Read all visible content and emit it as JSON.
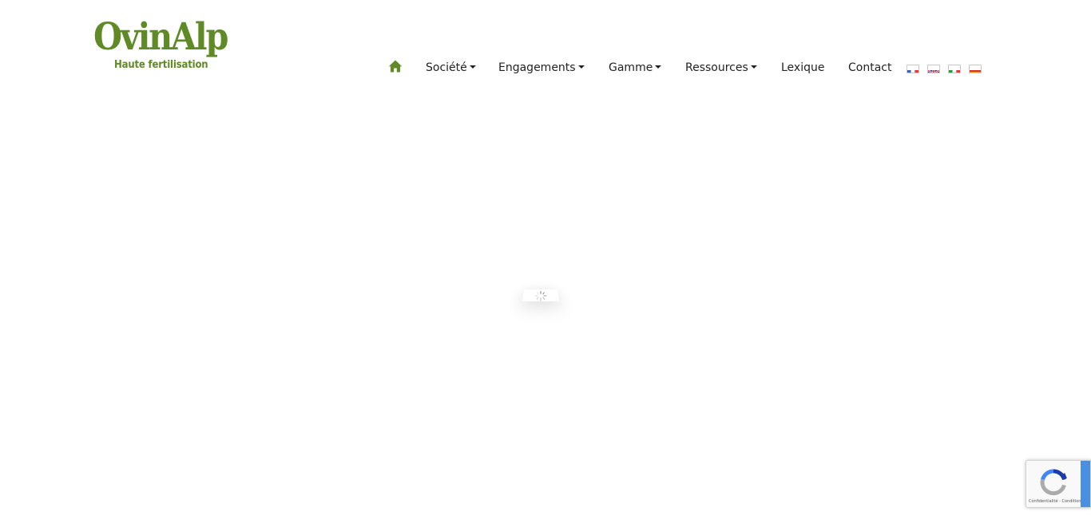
{
  "brand": {
    "name": "OvinAlp",
    "tagline": "Haute fertilisation",
    "color": "#5f8a26"
  },
  "nav": {
    "home_icon": "home-icon",
    "items": [
      {
        "label": "Société",
        "dropdown": true
      },
      {
        "label": "Engagements",
        "dropdown": true
      },
      {
        "label": "Gamme",
        "dropdown": true
      },
      {
        "label": "Ressources",
        "dropdown": true
      },
      {
        "label": "Lexique",
        "dropdown": false
      },
      {
        "label": "Contact",
        "dropdown": false
      }
    ],
    "languages": [
      {
        "code": "fr",
        "icon": "flag-france-icon"
      },
      {
        "code": "en",
        "icon": "flag-uk-icon"
      },
      {
        "code": "it",
        "icon": "flag-italy-icon"
      },
      {
        "code": "es",
        "icon": "flag-spain-icon"
      }
    ]
  },
  "loader": {
    "icon": "loading-spinner-icon"
  },
  "recaptcha": {
    "icon": "recaptcha-icon",
    "legal": "Confidentialité - Conditions",
    "accent": "#4a90e2"
  }
}
